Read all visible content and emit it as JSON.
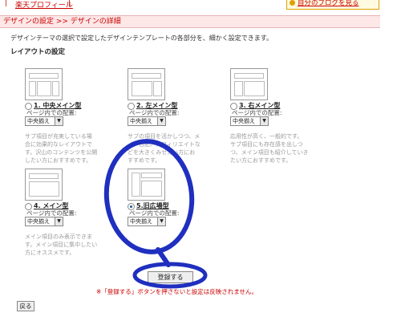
{
  "topbar": {
    "profile_link": "楽天プロフィール",
    "separator": "|",
    "view_blog": "自分のブログを見る"
  },
  "breadcrumb": "デザインの設定 >> デザインの詳細",
  "description": "デザインテーマの選択で設定したデザインテンプレートの各部分を、細かく設定できます。",
  "layout_heading": "レイアウトの設定",
  "templates": [
    {
      "name": "1. 中央メイン型",
      "pos_label": "ページ内での配置:",
      "select_value": "中央揃え",
      "selected": false,
      "hint": [
        "サブ項目が充実している場",
        "合に効果的なレイアウトで",
        "す。沢山のコンテンツを公開",
        "したい方におすすめです。"
      ]
    },
    {
      "name": "2. 左メイン型",
      "pos_label": "ページ内での配置:",
      "select_value": "中央揃え",
      "selected": false,
      "hint": [
        "サブの項目を活かしつつ、メ",
        "イン日記、アフィリエイトな",
        "どを大きくみせたい方にお",
        "すすめです。"
      ]
    },
    {
      "name": "3. 右メイン型",
      "pos_label": "ページ内での配置:",
      "select_value": "中央揃え",
      "selected": false,
      "hint": [
        "応用性が高く、一般的です。",
        "サブ項目にも存在感を出しつ",
        "つ、メイン項目も紹介していき",
        "たい方におすすめです。"
      ]
    },
    {
      "name": "4. メイン型",
      "pos_label": "ページ内での配置:",
      "select_value": "中央揃え",
      "selected": false,
      "hint": [
        "メイン項目のみ表示できま",
        "す。メイン項目に集中したい",
        "方にオススメです。"
      ]
    },
    {
      "name": "5.旧広場型",
      "pos_label": "ページ内での配置:",
      "select_value": "中央揃え",
      "selected": true,
      "hint": []
    }
  ],
  "register_button": "登録する",
  "notice": "※「登録する」ボタンを押さないと設定は反映されません。",
  "back_button": "戻る",
  "colors": {
    "accent": "#cc0000",
    "annotation": "#1f2fbf",
    "section_bg": "#fde7e7"
  }
}
